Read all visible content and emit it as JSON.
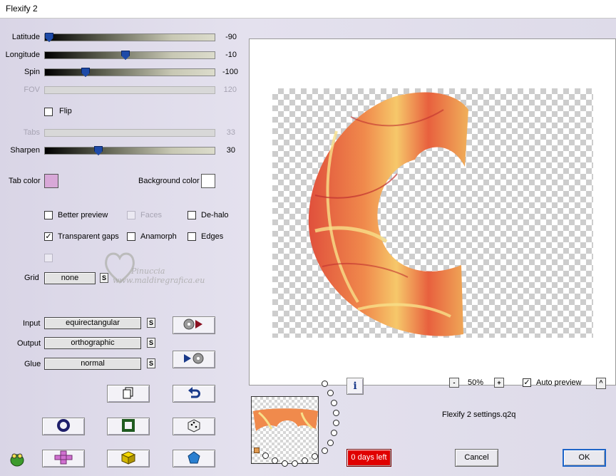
{
  "window": {
    "title": "Flexify 2"
  },
  "sliders": {
    "latitude": {
      "label": "Latitude",
      "value": "-90",
      "position": 0.03
    },
    "longitude": {
      "label": "Longitude",
      "value": "-10",
      "position": 0.47
    },
    "spin": {
      "label": "Spin",
      "value": "-100",
      "position": 0.22
    },
    "fov": {
      "label": "FOV",
      "value": "120"
    },
    "tabs": {
      "label": "Tabs",
      "value": "33"
    },
    "sharpen": {
      "label": "Sharpen",
      "value": "30",
      "position": 0.3
    }
  },
  "flip": {
    "label": "Flip",
    "checked": false
  },
  "colors": {
    "tab_color_label": "Tab color",
    "tab_color": "#d8a8d8",
    "background_color_label": "Background color",
    "background_color": "#ffffff"
  },
  "options": {
    "better_preview": {
      "label": "Better preview",
      "checked": false
    },
    "faces": {
      "label": "Faces",
      "checked": false,
      "disabled": true
    },
    "de_halo": {
      "label": "De-halo",
      "checked": false
    },
    "transparent_gaps": {
      "label": "Transparent gaps",
      "checked": true
    },
    "anamorph": {
      "label": "Anamorph",
      "checked": false
    },
    "edges": {
      "label": "Edges",
      "checked": false
    }
  },
  "grid": {
    "label": "Grid",
    "value": "none"
  },
  "projection": {
    "input_label": "Input",
    "input_value": "equirectangular",
    "output_label": "Output",
    "output_value": "orthographic",
    "glue_label": "Glue",
    "glue_value": "normal",
    "s_label": "S"
  },
  "watermark": {
    "line1": "Pinuccia",
    "line2": "www.maldiregrafica.eu"
  },
  "zoom": {
    "minus": "-",
    "value": "50%",
    "plus": "+"
  },
  "auto_preview": {
    "label": "Auto preview",
    "checked": true,
    "arrow": "^"
  },
  "settings_file": "Flexify 2 settings.q2q",
  "info_icon": "i",
  "trial": {
    "label": "0 days left",
    "color": "#e00000"
  },
  "buttons": {
    "cancel": "Cancel",
    "ok": "OK"
  },
  "accent": "#1e4aa8"
}
